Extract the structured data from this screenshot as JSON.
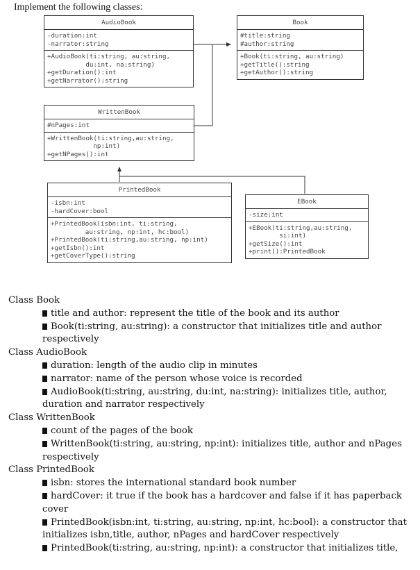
{
  "heading": "Implement the following classes:",
  "diagram": {
    "classes": {
      "audiobook": {
        "name": "AudioBook",
        "attributes": [
          "-duration:int",
          "-narrator:string"
        ],
        "methods": [
          "+AudioBook(ti:string, au:string,",
          "          du:int, na:string)",
          "+getDuration():int",
          "+getNarrator():string"
        ]
      },
      "book": {
        "name": "Book",
        "attributes": [
          "#title:string",
          "#author:string"
        ],
        "methods": [
          "+Book(ti:string, au:string)",
          "+getTitle():string",
          "+getAuthor():string"
        ]
      },
      "writtenbook": {
        "name": "WrittenBook",
        "attributes": [
          "#nPages:int"
        ],
        "methods": [
          "+WrittenBook(ti:string,au:string,",
          "            np:int)",
          "+getNPages():int"
        ]
      },
      "printedbook": {
        "name": "PrintedBook",
        "attributes": [
          "-isbn:int",
          "-hardCover:bool"
        ],
        "methods": [
          "+PrintedBook(isbn:int, ti:string,",
          "         au:string, np:int, hc:bool)",
          "+PrintedBook(ti:string,au:string, np:int)",
          "+getIsbn():int",
          "+getCoverType():string"
        ]
      },
      "ebook": {
        "name": "EBook",
        "attributes": [
          "-size:int"
        ],
        "methods": [
          "+EBook(ti:string,au:string,",
          "        si:int)",
          "+getSize():int",
          "+print():PrintedBook"
        ]
      }
    },
    "relations": [
      {
        "from": "AudioBook",
        "to": "Book",
        "type": "inheritance"
      },
      {
        "from": "WrittenBook",
        "to": "Book",
        "type": "inheritance"
      },
      {
        "from": "PrintedBook",
        "to": "WrittenBook",
        "type": "inheritance"
      },
      {
        "from": "EBook",
        "to": "WrittenBook",
        "type": "inheritance"
      }
    ]
  },
  "sections": [
    {
      "title": "Class Book",
      "items": [
        {
          "text": "title and author: represent the title of the book and its author"
        },
        {
          "text": "Book(ti:string, au:string): a constructor that initializes title and author",
          "cont": "respectively"
        }
      ]
    },
    {
      "title": "Class AudioBook",
      "items": [
        {
          "text": "duration: length of the audio clip in minutes"
        },
        {
          "text": "narrator: name of the person whose voice is recorded"
        },
        {
          "text": "AudioBook(ti:string, au:string, du:int, na:string): initializes title, author,",
          "cont": "duration and narrator respectively"
        }
      ]
    },
    {
      "title": "Class WrittenBook",
      "items": [
        {
          "text": "count of the pages of the book"
        },
        {
          "text": "WrittenBook(ti:string, au:string, np:int): initializes title, author and nPages",
          "cont": "respectively"
        }
      ]
    },
    {
      "title": "Class PrintedBook",
      "items": [
        {
          "text": "isbn: stores the international standard book number"
        },
        {
          "text": "hardCover: it true if the book has a hardcover and false if it has paperback",
          "cont": "cover"
        },
        {
          "text": "PrintedBook(isbn:int, ti:string, au:string, np:int, hc:bool): a constructor that",
          "cont": "initializes isbn,title, author, nPages and hardCover respectively"
        },
        {
          "text": "PrintedBook(ti:string, au:string, np:int): a constructor that initializes title,"
        }
      ]
    }
  ]
}
